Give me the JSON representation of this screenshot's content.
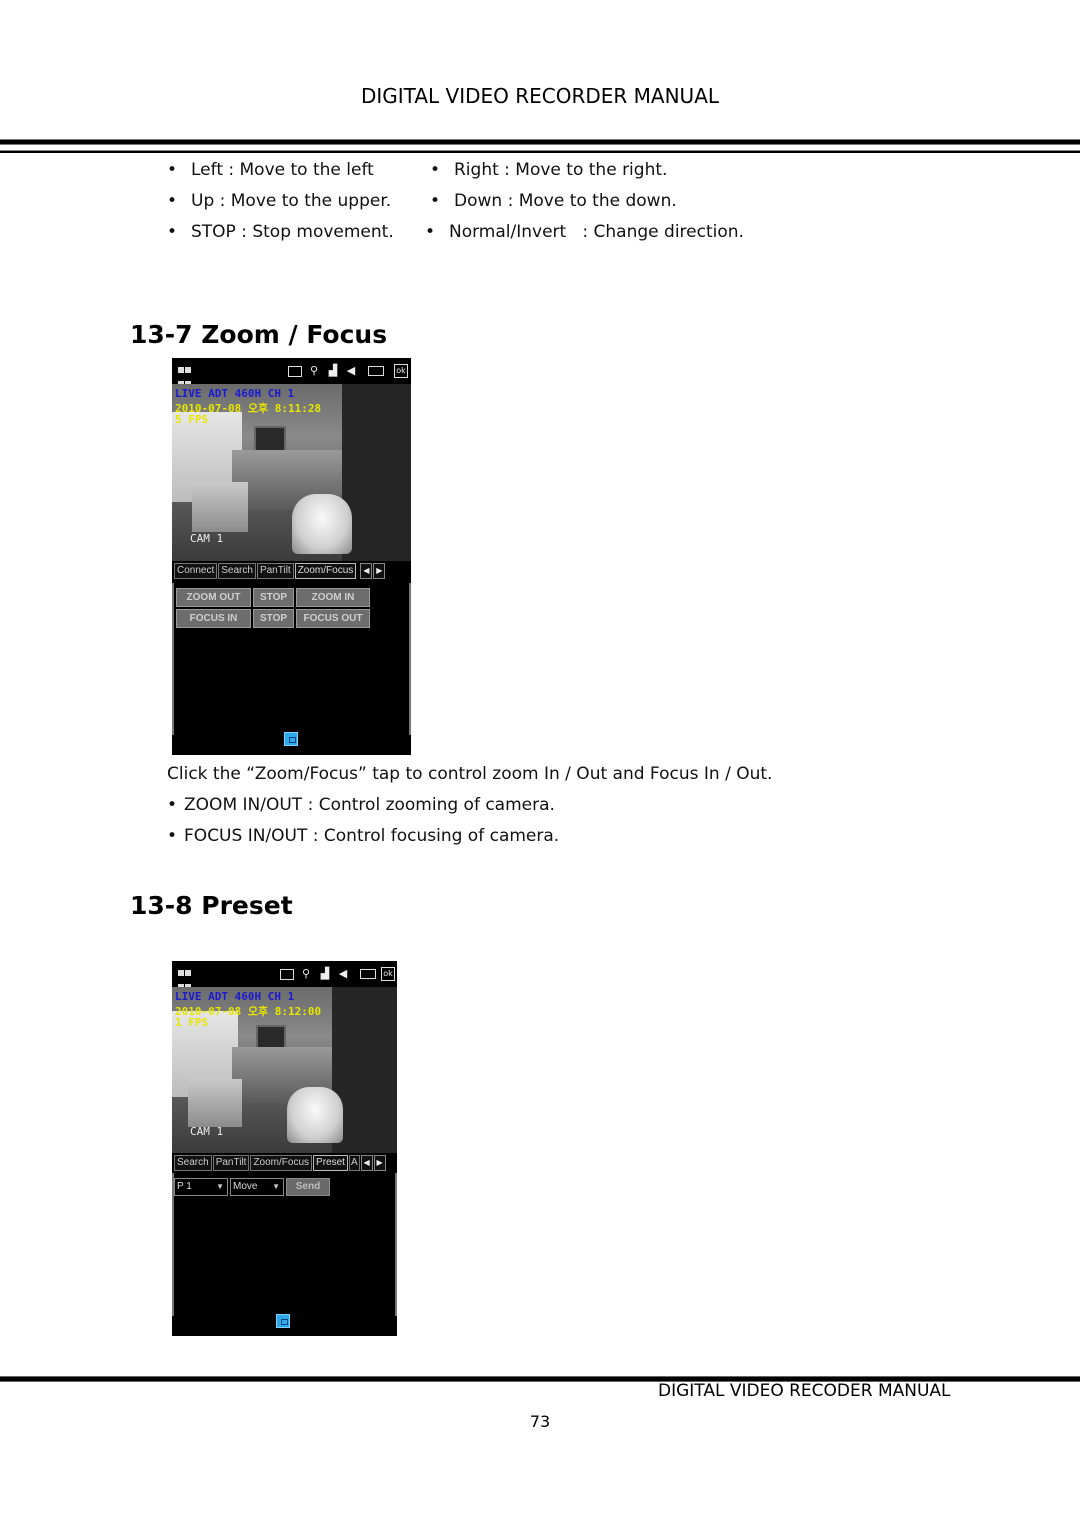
{
  "header": {
    "title": "DIGITAL VIDEO RECORDER MANUAL"
  },
  "pantilt_bullets": [
    {
      "left": "Left : Move to the left",
      "right": "Right : Move to the right."
    },
    {
      "left": "Up : Move to the upper.",
      "right": "Down : Move to the down."
    },
    {
      "left": "STOP : Stop movement.",
      "right": "Normal/Invert   : Change direction."
    }
  ],
  "bullet_glyph": "•",
  "section_zoom": {
    "heading": "13-7 Zoom / Focus",
    "screenshot": {
      "overlay_live": "LIVE ADT 460H CH 1",
      "overlay_datetime": "2010-07-08 오후 8:11:28",
      "overlay_fps": "5 FPS",
      "overlay_cam": "CAM 1",
      "status_icons": [
        "windows-start-icon",
        "message-icon",
        "connectivity-icon",
        "signal-icon",
        "volume-icon",
        "battery-icon",
        "ok-icon"
      ],
      "ok_label": "ok",
      "tabs": [
        "Connect",
        "Search",
        "PanTilt",
        "Zoom/Focus"
      ],
      "active_tab": "Zoom/Focus",
      "arrow_left": "◀",
      "arrow_right": "▶",
      "buttons": [
        [
          "ZOOM OUT",
          "STOP",
          "ZOOM IN"
        ],
        [
          "FOCUS IN",
          "STOP",
          "FOCUS OUT"
        ]
      ]
    },
    "description": "Click the “Zoom/Focus” tap to control zoom In / Out and Focus In / Out.",
    "bullets": [
      "ZOOM IN/OUT : Control zooming of camera.",
      "FOCUS IN/OUT : Control focusing of camera."
    ]
  },
  "section_preset": {
    "heading": "13-8 Preset",
    "screenshot": {
      "overlay_live": "LIVE ADT 460H CH 1",
      "overlay_datetime": "2010-07-08 오후 8:12:00",
      "overlay_fps": "1 FPS",
      "overlay_cam": "CAM 1",
      "ok_label": "ok",
      "tabs": [
        "Search",
        "PanTilt",
        "Zoom/Focus",
        "Preset",
        "A"
      ],
      "active_tab": "Preset",
      "arrow_left": "◀",
      "arrow_right": "▶",
      "preset_select": "P 1",
      "action_select": "Move",
      "send_label": "Send",
      "caret": "▼"
    }
  },
  "footer": {
    "title": "DIGITAL VIDEO RECODER MANUAL",
    "page_number": "73"
  }
}
